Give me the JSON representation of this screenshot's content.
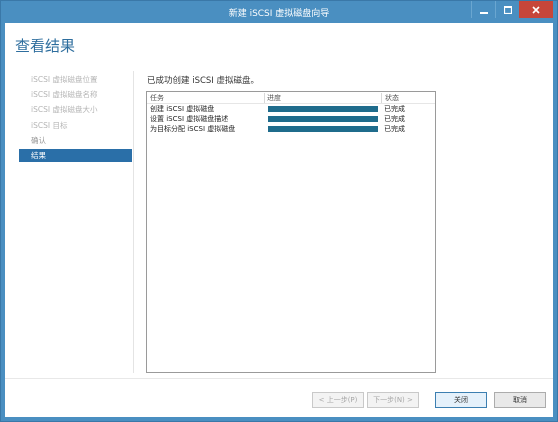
{
  "window": {
    "title": "新建 iSCSI 虚拟磁盘向导"
  },
  "page": {
    "title": "查看结果",
    "success_message": "已成功创建 iSCSI 虚拟磁盘。"
  },
  "nav": {
    "items": [
      {
        "label": "iSCSI 虚拟磁盘位置",
        "state": "completed"
      },
      {
        "label": "iSCSI 虚拟磁盘名称",
        "state": "completed"
      },
      {
        "label": "iSCSI 虚拟磁盘大小",
        "state": "completed"
      },
      {
        "label": "iSCSI 目标",
        "state": "completed"
      },
      {
        "label": "确认",
        "state": "completed"
      },
      {
        "label": "结果",
        "state": "active"
      }
    ]
  },
  "table": {
    "columns": [
      "任务",
      "进度",
      "状态"
    ],
    "rows": [
      {
        "task": "创建 iSCSI 虚拟磁盘",
        "progress": 1.0,
        "status": "已完成"
      },
      {
        "task": "设置 iSCSI 虚拟磁盘描述",
        "progress": 1.0,
        "status": "已完成"
      },
      {
        "task": "为目标分配 iSCSI 虚拟磁盘",
        "progress": 1.0,
        "status": "已完成"
      }
    ]
  },
  "buttons": {
    "prev": "< 上一步(P)",
    "next": "下一步(N) >",
    "close": "关闭",
    "cancel": "取消"
  },
  "colors": {
    "titlebar": "#4a8fc1",
    "accent": "#2a6fa8",
    "progress_fill": "#1f6c8c",
    "close_button": "#c7463a"
  }
}
